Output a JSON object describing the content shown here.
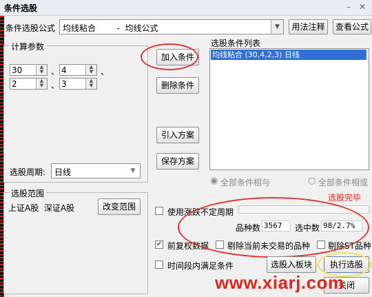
{
  "window": {
    "title": "条件选股"
  },
  "formula": {
    "label": "条件选股公式",
    "value": "均线粘合        -  均线公式",
    "usage_button": "用法注释",
    "view_button": "查看公式"
  },
  "params": {
    "group_label": "计算参数",
    "p1": "30",
    "p2": "4",
    "p3": "2",
    "p4": "3",
    "sep": "、",
    "period_label": "选股周期:",
    "period_value": "日线"
  },
  "actions": {
    "add": "加入条件",
    "delete": "删除条件",
    "import": "引入方案",
    "save": "保存方案"
  },
  "conditions": {
    "label": "选股条件列表",
    "items": [
      "均线粘合 (30,4,2,3) 日线"
    ]
  },
  "logic": {
    "all_and": "全部条件相与",
    "all_or": "全部条件相或"
  },
  "status": {
    "text": "选股完毕"
  },
  "range": {
    "group_label": "选股范围",
    "value": "上证A股  深证A股",
    "change_button": "改变范围"
  },
  "options": {
    "uncertain_period": "使用涨跌不定周期",
    "count_label": "品种数",
    "count_value": "3567",
    "selected_label": "选中数",
    "selected_value": "98/2.7%",
    "forward_adjust": "前复权数据",
    "exclude_untraded": "剔除当前未交易的品种",
    "exclude_st": "剔除ST品种",
    "time_period": "时间段内满足条件"
  },
  "bottom": {
    "to_block": "选股入板块",
    "execute": "执行选股",
    "close": "关闭"
  },
  "watermark": "www.xiarj.com",
  "colors": {
    "highlight": "#2e6fd8",
    "annotation": "#d8362f",
    "watermark": "#e0251b",
    "status": "#e0251b"
  }
}
